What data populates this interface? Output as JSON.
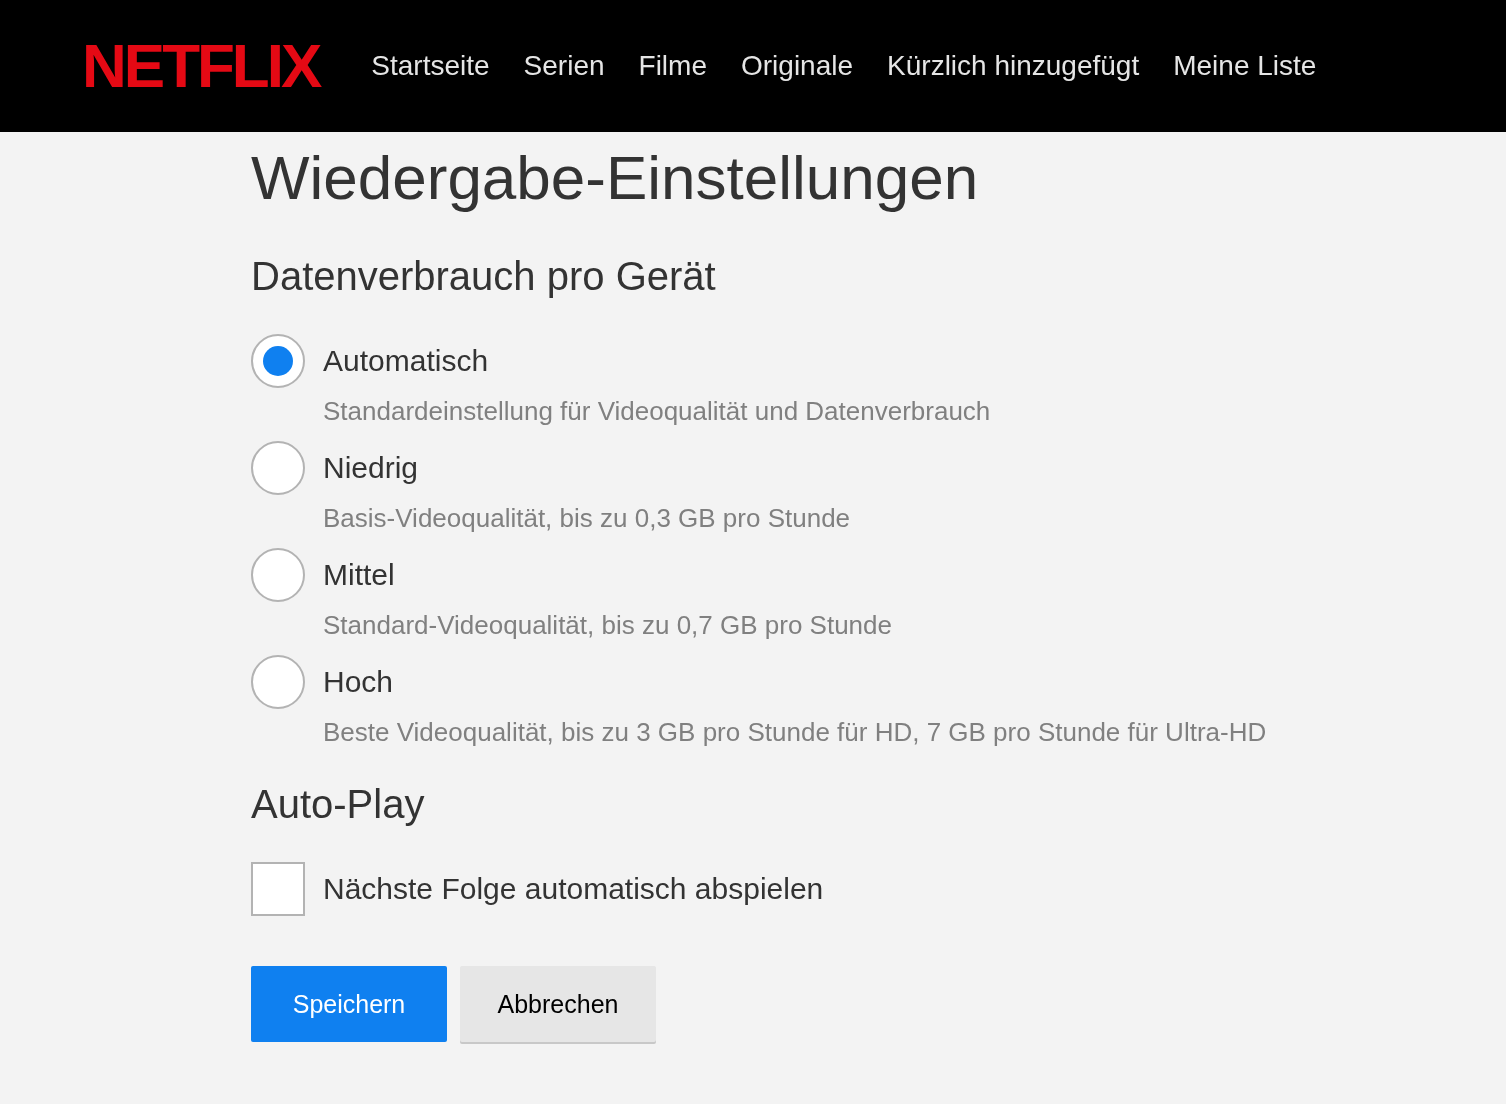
{
  "header": {
    "logo": "NETFLIX",
    "nav": [
      "Startseite",
      "Serien",
      "Filme",
      "Originale",
      "Kürzlich hinzugefügt",
      "Meine Liste"
    ]
  },
  "title": "Wiedergabe-Einstellungen",
  "data_usage": {
    "heading": "Datenverbrauch pro Gerät",
    "options": [
      {
        "label": "Automatisch",
        "description": "Standardeinstellung für Videoqualität und Datenverbrauch",
        "selected": true
      },
      {
        "label": "Niedrig",
        "description": "Basis-Videoqualität, bis zu 0,3 GB pro Stunde",
        "selected": false
      },
      {
        "label": "Mittel",
        "description": "Standard-Videoqualität, bis zu 0,7 GB pro Stunde",
        "selected": false
      },
      {
        "label": "Hoch",
        "description": "Beste Videoqualität, bis zu 3 GB pro Stunde für HD, 7 GB pro Stunde für Ultra-HD",
        "selected": false
      }
    ]
  },
  "autoplay": {
    "heading": "Auto-Play",
    "label": "Nächste Folge automatisch abspielen",
    "checked": false
  },
  "buttons": [
    {
      "label": "Speichern",
      "kind": "primary"
    },
    {
      "label": "Abbrechen",
      "kind": "secondary"
    }
  ]
}
